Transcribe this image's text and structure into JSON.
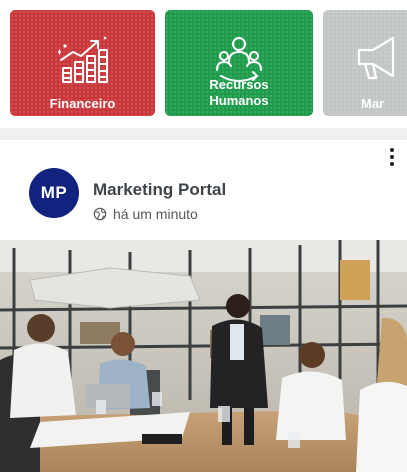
{
  "categories": [
    {
      "label": "Financeiro",
      "icon": "finance-chart-icon",
      "color": "#c9373b"
    },
    {
      "label": "Recursos\nHumanos",
      "icon": "human-resources-icon",
      "color": "#1e9c4c"
    },
    {
      "label": "Mar",
      "icon": "megaphone-icon",
      "color": "#c3c7c4"
    }
  ],
  "post": {
    "avatar_initials": "MP",
    "author": "Marketing Portal",
    "time": "há um minuto",
    "image": "office-meeting-photo"
  }
}
